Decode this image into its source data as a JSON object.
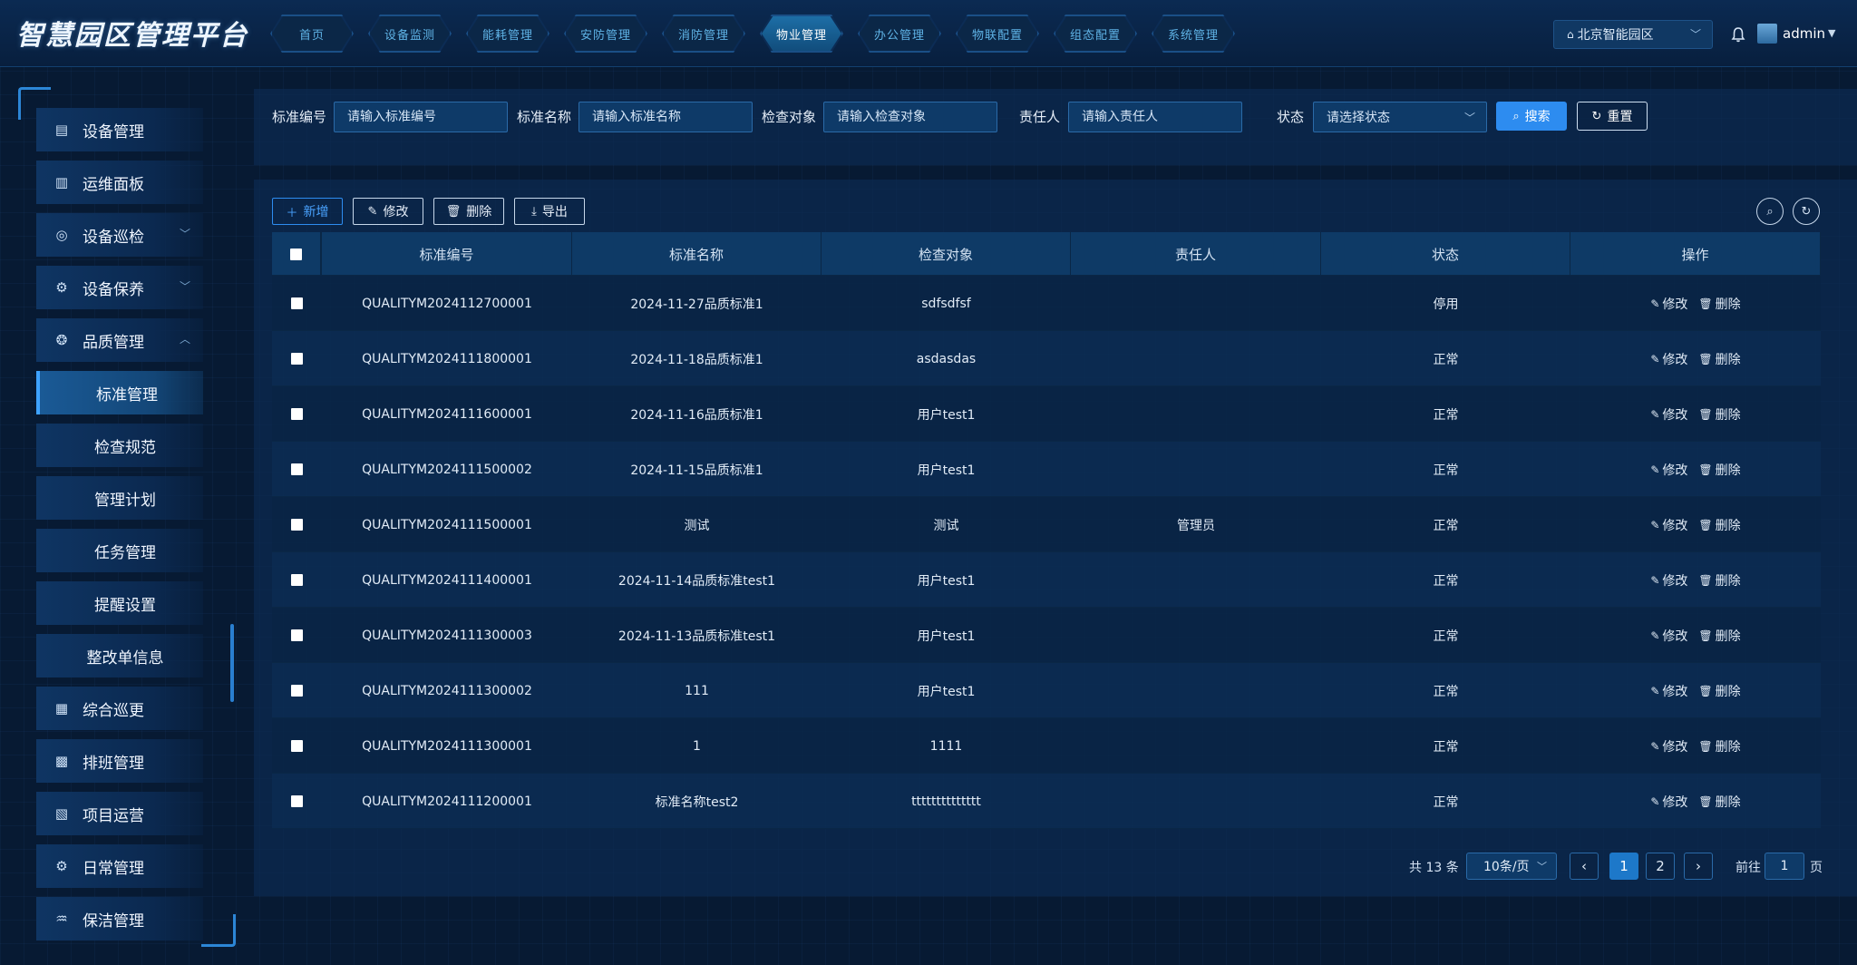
{
  "app": {
    "title": "智慧园区管理平台"
  },
  "nav": [
    {
      "label": "首页"
    },
    {
      "label": "设备监测"
    },
    {
      "label": "能耗管理"
    },
    {
      "label": "安防管理"
    },
    {
      "label": "消防管理"
    },
    {
      "label": "物业管理",
      "active": true
    },
    {
      "label": "办公管理"
    },
    {
      "label": "物联配置"
    },
    {
      "label": "组态配置"
    },
    {
      "label": "系统管理"
    }
  ],
  "header": {
    "region": "北京智能园区",
    "username": "admin"
  },
  "sidebar": {
    "items": [
      {
        "label": "设备管理",
        "icon": "server-icon",
        "glyph": "▤"
      },
      {
        "label": "运维面板",
        "icon": "dashboard-icon",
        "glyph": "▥"
      },
      {
        "label": "设备巡检",
        "icon": "inspect-icon",
        "glyph": "◎",
        "expandable": true
      },
      {
        "label": "设备保养",
        "icon": "maintenance-icon",
        "glyph": "⚙",
        "expandable": true
      },
      {
        "label": "品质管理",
        "icon": "quality-icon",
        "glyph": "❂",
        "expandable": true,
        "expanded": true
      }
    ],
    "subitems": [
      {
        "label": "标准管理",
        "active": true
      },
      {
        "label": "检查规范"
      },
      {
        "label": "管理计划"
      },
      {
        "label": "任务管理"
      },
      {
        "label": "提醒设置"
      },
      {
        "label": "整改单信息"
      }
    ],
    "items_after": [
      {
        "label": "综合巡更",
        "icon": "building-icon",
        "glyph": "▦"
      },
      {
        "label": "排班管理",
        "icon": "calendar-icon",
        "glyph": "▩"
      },
      {
        "label": "项目运营",
        "icon": "chart-icon",
        "glyph": "▧"
      },
      {
        "label": "日常管理",
        "icon": "settings-icon",
        "glyph": "⚙"
      },
      {
        "label": "保洁管理",
        "icon": "cleaning-icon",
        "glyph": "♒"
      }
    ]
  },
  "filters": {
    "code_label": "标准编号",
    "code_placeholder": "请输入标准编号",
    "name_label": "标准名称",
    "name_placeholder": "请输入标准名称",
    "object_label": "检查对象",
    "object_placeholder": "请输入检查对象",
    "owner_label": "责任人",
    "owner_placeholder": "请输入责任人",
    "status_label": "状态",
    "status_placeholder": "请选择状态",
    "search_label": "搜索",
    "reset_label": "重置"
  },
  "toolbar": {
    "add": "新增",
    "edit": "修改",
    "delete": "删除",
    "export": "导出"
  },
  "table": {
    "columns": [
      "标准编号",
      "标准名称",
      "检查对象",
      "责任人",
      "状态",
      "操作"
    ],
    "rows": [
      {
        "code": "QUALITYM2024112700001",
        "name": "2024-11-27品质标准1",
        "object": "sdfsdfsf",
        "owner": "",
        "status": "停用"
      },
      {
        "code": "QUALITYM2024111800001",
        "name": "2024-11-18品质标准1",
        "object": "asdasdas",
        "owner": "",
        "status": "正常"
      },
      {
        "code": "QUALITYM2024111600001",
        "name": "2024-11-16品质标准1",
        "object": "用户test1",
        "owner": "",
        "status": "正常"
      },
      {
        "code": "QUALITYM2024111500002",
        "name": "2024-11-15品质标准1",
        "object": "用户test1",
        "owner": "",
        "status": "正常"
      },
      {
        "code": "QUALITYM2024111500001",
        "name": "测试",
        "object": "测试",
        "owner": "管理员",
        "status": "正常"
      },
      {
        "code": "QUALITYM2024111400001",
        "name": "2024-11-14品质标准test1",
        "object": "用户test1",
        "owner": "",
        "status": "正常"
      },
      {
        "code": "QUALITYM2024111300003",
        "name": "2024-11-13品质标准test1",
        "object": "用户test1",
        "owner": "",
        "status": "正常"
      },
      {
        "code": "QUALITYM2024111300002",
        "name": "111",
        "object": "用户test1",
        "owner": "",
        "status": "正常"
      },
      {
        "code": "QUALITYM2024111300001",
        "name": "1",
        "object": "1111",
        "owner": "",
        "status": "正常"
      },
      {
        "code": "QUALITYM2024111200001",
        "name": "标准名称test2",
        "object": "tttttttttttttt",
        "owner": "",
        "status": "正常"
      }
    ],
    "row_actions": {
      "edit": "修改",
      "delete": "删除"
    }
  },
  "pagination": {
    "total": "共 13 条",
    "page_size": "10条/页",
    "pages": [
      "1",
      "2"
    ],
    "current": "1",
    "goto_prefix": "前往",
    "goto_value": "1",
    "goto_suffix": "页"
  },
  "colors": {
    "accent": "#2d8cf0",
    "background": "#071a33",
    "panel": "#0c2a50"
  }
}
